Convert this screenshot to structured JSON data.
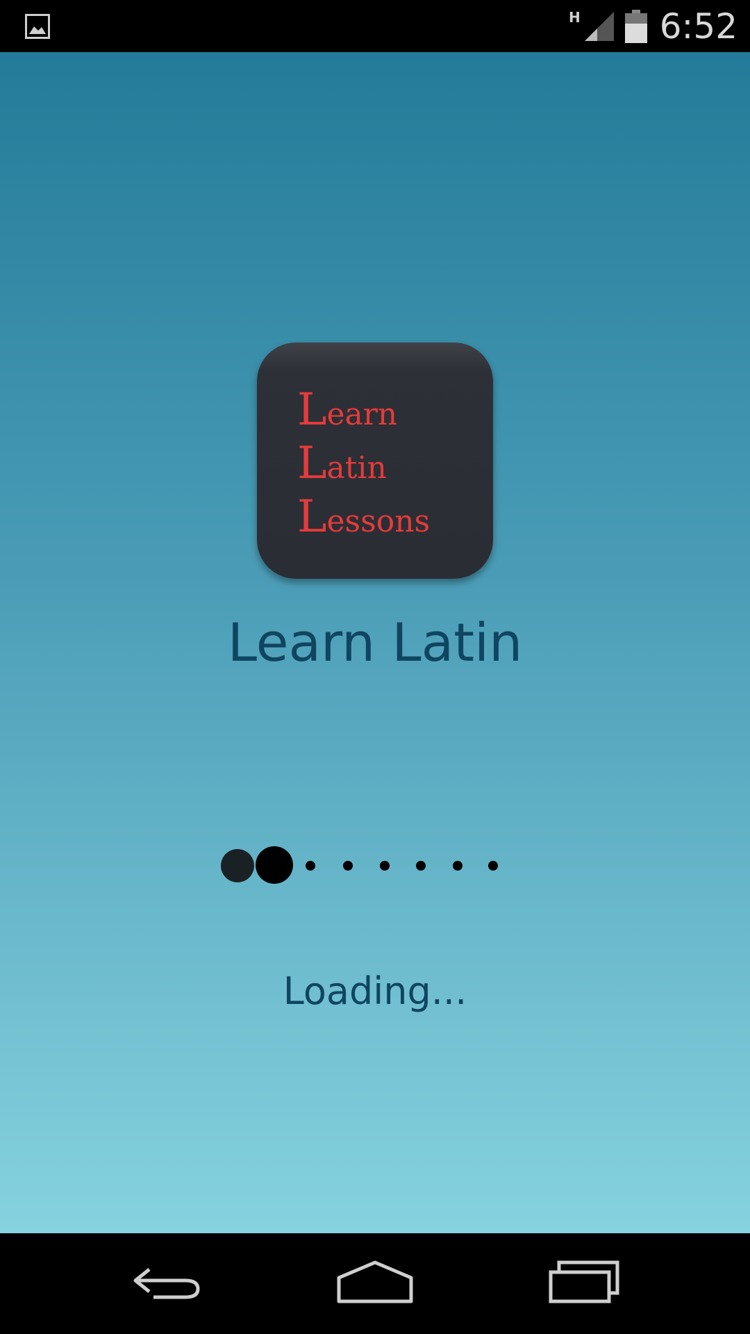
{
  "status_bar": {
    "network_type": "H",
    "time": "6:52",
    "left_icon": "image-notification-icon",
    "signal_icon": "signal-icon",
    "battery_icon": "battery-icon"
  },
  "app": {
    "icon_lines": [
      "Learn",
      "Latin",
      "Lessons"
    ],
    "title": "Learn Latin",
    "loading_text": "Loading...",
    "loading_indicator": {
      "total_dots": 8,
      "active_dots": 2
    }
  },
  "nav_bar": {
    "back_icon": "back-icon",
    "home_icon": "home-icon",
    "recents_icon": "recents-icon"
  },
  "colors": {
    "gradient_top": "#237b99",
    "gradient_bottom": "#86d2df",
    "title_text": "#0f4561",
    "icon_text": "#e63b3b",
    "icon_bg": "#2a2d34"
  }
}
